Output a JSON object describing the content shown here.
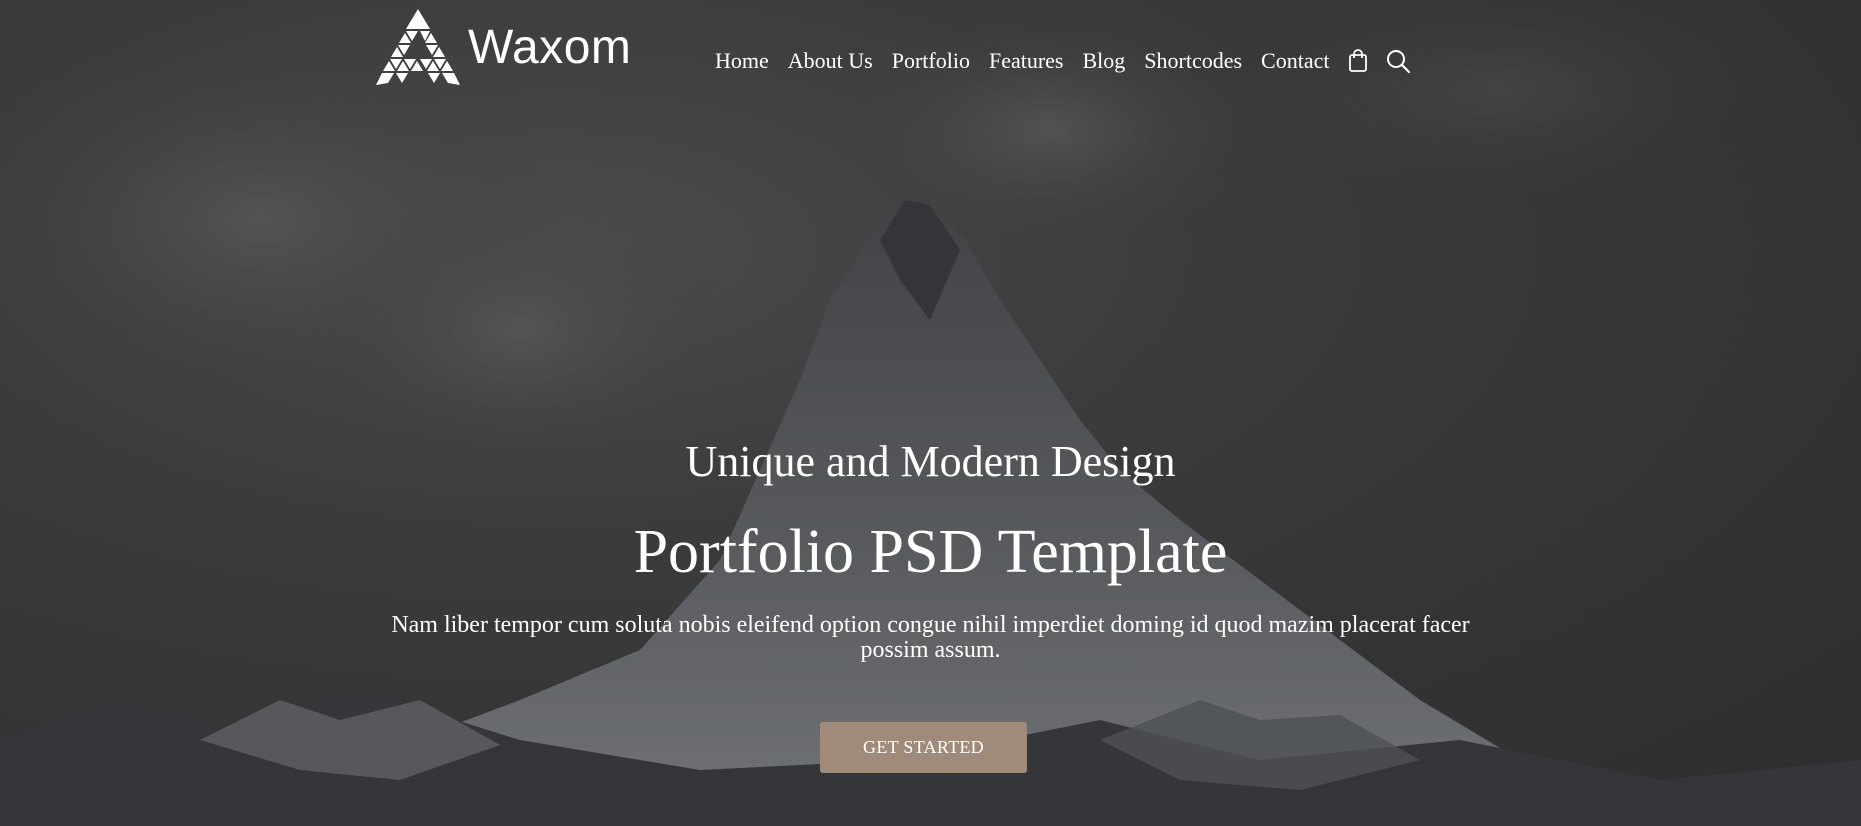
{
  "brand": {
    "name": "Waxom",
    "logo_icon": "triangle-mosaic-logo"
  },
  "nav": {
    "items": [
      {
        "label": "Home"
      },
      {
        "label": "About Us"
      },
      {
        "label": "Portfolio"
      },
      {
        "label": "Features"
      },
      {
        "label": "Blog"
      },
      {
        "label": "Shortcodes"
      },
      {
        "label": "Contact"
      }
    ],
    "icons": [
      "shopping-bag-icon",
      "search-icon"
    ]
  },
  "hero": {
    "background": "snow-capped-mountain-peak-under-clouds",
    "eyebrow": "Unique and Modern Design",
    "headline": "Portfolio PSD Template",
    "lead": "Nam liber tempor cum soluta nobis eleifend option congue nihil imperdiet doming id quod mazim placerat facer possim assum.",
    "cta_label": "GET STARTED"
  },
  "colors": {
    "accent": "#a08b7a",
    "text": "#ffffff",
    "background": "#3b3b3b"
  }
}
